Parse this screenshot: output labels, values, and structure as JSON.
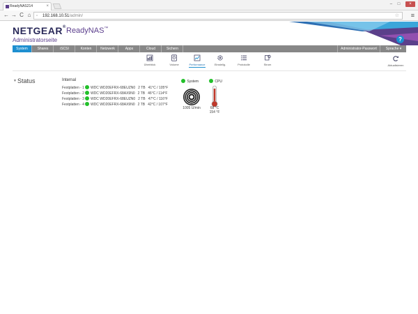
{
  "browser": {
    "tab_title": "ReadyNAS214",
    "tab_close": "×",
    "url_host": "192.168.10.51",
    "url_path": "/admin/",
    "back": "←",
    "forward": "→",
    "reload": "C",
    "home": "⌂",
    "star": "☆",
    "menu": "≡",
    "win_min": "–",
    "win_max": "□",
    "win_close": "×"
  },
  "header": {
    "brand": "NETGEAR",
    "brand_sup": "®",
    "product": "ReadyNAS",
    "product_sup": "™",
    "subtitle": "Administratorseite",
    "help": "?"
  },
  "main_nav": {
    "items": [
      {
        "label": "System",
        "active": true
      },
      {
        "label": "Shares"
      },
      {
        "label": "iSCSI"
      },
      {
        "label": "Konten"
      },
      {
        "label": "Netzwerk"
      },
      {
        "label": "Apps"
      },
      {
        "label": "Cloud"
      },
      {
        "label": "Sichern"
      }
    ],
    "admin_password": "Administrator-Passwort",
    "language": "Sprache ▾"
  },
  "sub_nav": {
    "items": [
      {
        "label": "Überblick"
      },
      {
        "label": "Volume"
      },
      {
        "label": "Performance",
        "active": true
      },
      {
        "label": "Einstellg."
      },
      {
        "label": "Protokolle"
      },
      {
        "label": "Strom"
      }
    ],
    "refresh": "Aktualisieren"
  },
  "status": {
    "toggle": "▼",
    "title": "Status",
    "internal": "Internal",
    "disks": [
      {
        "label": "Festplatten - 1",
        "model": "WDC WD20EFRX-68EUZN0",
        "size": "2 TB",
        "temp": "41°C / 105°F"
      },
      {
        "label": "Festplatten - 2",
        "model": "WDC WD20EFRX-68AX9N0",
        "size": "2 TB",
        "temp": "46°C / 114°F"
      },
      {
        "label": "Festplatten - 3",
        "model": "WDC WD20EFRX-68EUZN0",
        "size": "2 TB",
        "temp": "47°C / 116°F"
      },
      {
        "label": "Festplatten - 4",
        "model": "WDC WD20EFRX-68AX9N0",
        "size": "2 TB",
        "temp": "42°C / 107°F"
      }
    ],
    "system_label": "System",
    "fan_speed": "1005 U/min",
    "cpu_label": "CPU",
    "cpu_temp_c": "68 °C",
    "cpu_temp_f": "154 °F"
  },
  "colors": {
    "accent": "#1e8fd0",
    "nav_bg": "#878787",
    "status_ok": "#22c02a",
    "brand_purple": "#5a3d8c"
  }
}
